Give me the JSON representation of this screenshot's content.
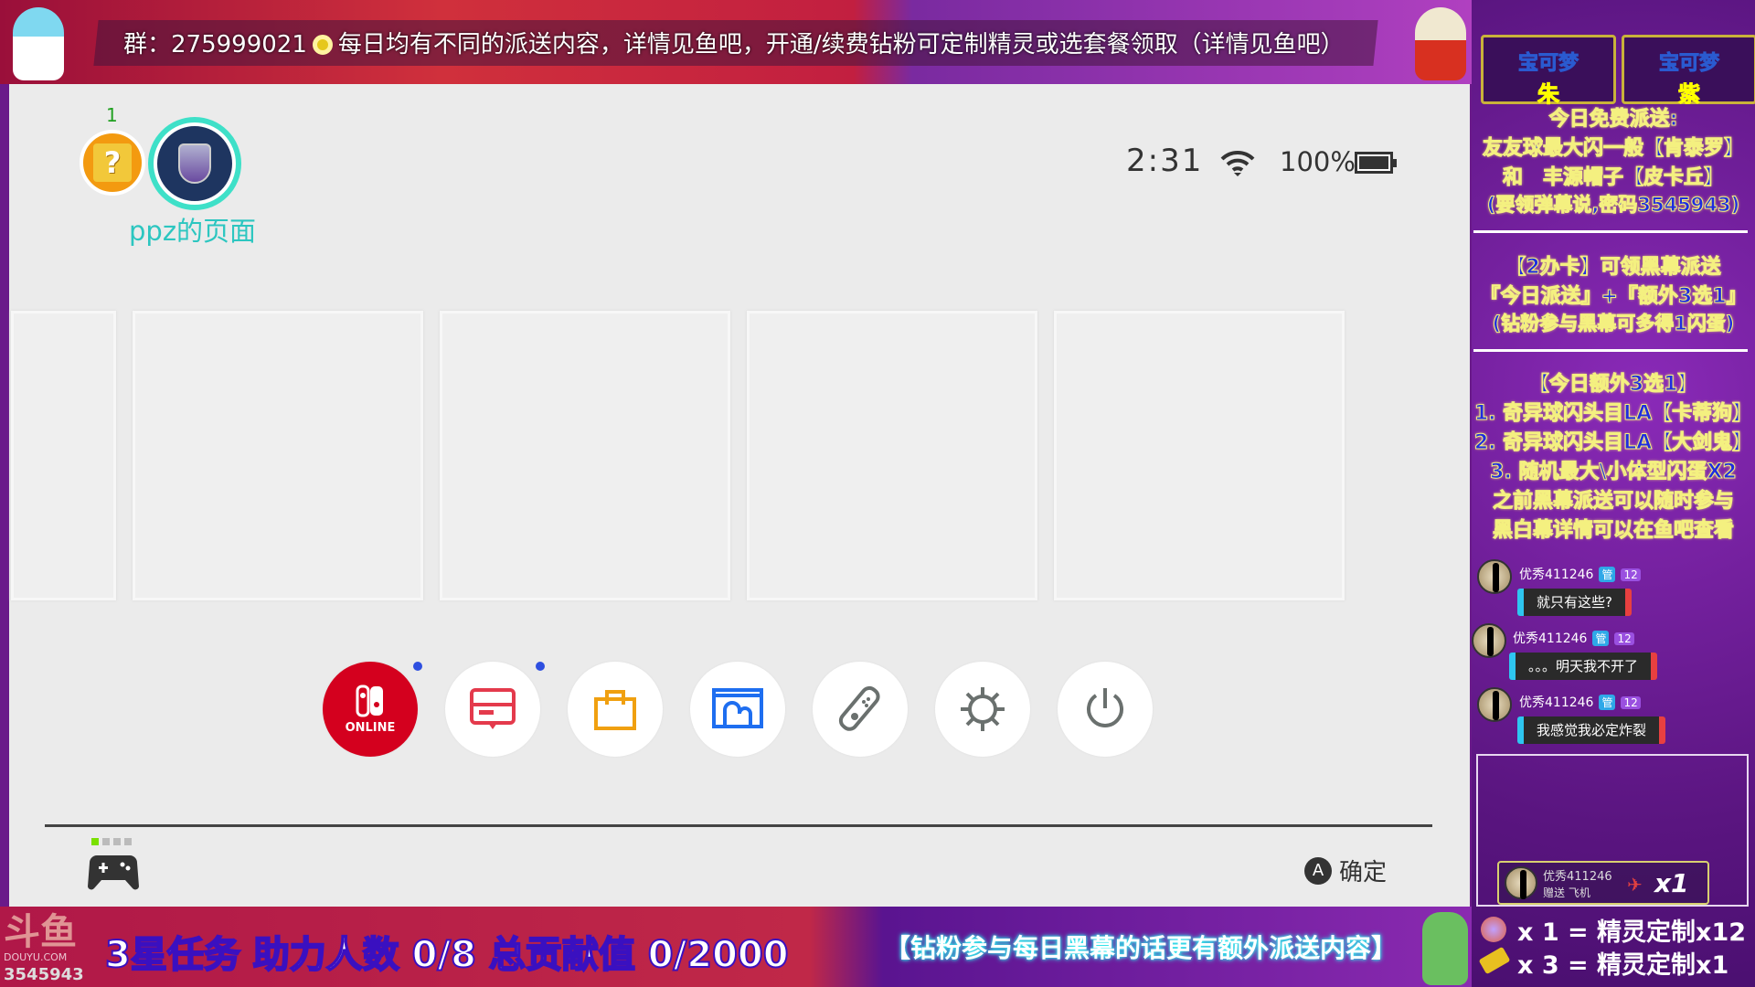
{
  "top_banner": {
    "group_text": "群：275999021",
    "message": "每日均有不同的派送内容，详情见鱼吧，开通/续费钻粉可定制精灵或选套餐领取（详情见鱼吧）"
  },
  "switch": {
    "users": [
      {
        "name": "question-block-user",
        "badge": "1"
      },
      {
        "name": "ppz",
        "page_label": "ppz的页面",
        "ring_color": "#3ee0c8"
      }
    ],
    "status": {
      "time": "2:31",
      "wifi": "connected",
      "battery": "100%",
      "battery_level": 100
    },
    "tiles": 5,
    "nav_icons": [
      {
        "name": "nintendo-switch-online",
        "label": "ONLINE",
        "color": "#d4001e",
        "notification": true
      },
      {
        "name": "news",
        "color": "#e43a4c",
        "notification": true
      },
      {
        "name": "eshop",
        "color": "#f0a010"
      },
      {
        "name": "album",
        "color": "#1e6ef0"
      },
      {
        "name": "controllers",
        "color": "#6a706e"
      },
      {
        "name": "system-settings",
        "color": "#6a706e"
      },
      {
        "name": "sleep-mode",
        "color": "#6a706e"
      }
    ],
    "footer": {
      "a_button": "A",
      "confirm_label": "确定",
      "player_indicator": 1
    }
  },
  "right_panel": {
    "logos": [
      {
        "title": "宝可梦",
        "sub": "朱"
      },
      {
        "title": "宝可梦",
        "sub": "紫"
      }
    ],
    "block1": [
      "今日免费派送:",
      "友友球最大闪一般【肯泰罗】",
      "和　丰源帽子【皮卡丘】",
      "(要领弹幕说,密码3545943)"
    ],
    "block2": [
      "【2办卡】可领黑幕派送",
      "『今日派送』+『额外3选1』",
      "(钻粉参与黑幕可多得1闪蛋)"
    ],
    "block3": [
      "【今日额外3选1】",
      "1. 奇异球闪头目LA【卡蒂狗】",
      "2. 奇异球闪头目LA【大剑鬼】",
      "3. 随机最大\\小体型闪蛋X2",
      "之前黑幕派送可以随时参与",
      "黑白幕详情可以在鱼吧查看"
    ],
    "chat": [
      {
        "user": "优秀411246",
        "role": "管",
        "level": "12",
        "message": "就只有这些?"
      },
      {
        "user": "优秀411246",
        "role": "管",
        "level": "12",
        "message": "。。。明天我不开了"
      },
      {
        "user": "优秀411246",
        "role": "管",
        "level": "12",
        "message": "我感觉我必定炸裂"
      }
    ],
    "gift": {
      "user": "优秀411246",
      "action": "赠送 飞机",
      "count": "x1"
    },
    "rewards": [
      "x 1 = 精灵定制x12",
      "x 3 = 精灵定制x1"
    ]
  },
  "bottom_bar": {
    "logo": "斗鱼 DOUYU.COM",
    "room_id": "3545943",
    "task": "3星任务 助力人数 0/8 总贡献值 0/2000",
    "promo": "【钻粉参与每日黑幕的话更有额外派送内容】"
  }
}
